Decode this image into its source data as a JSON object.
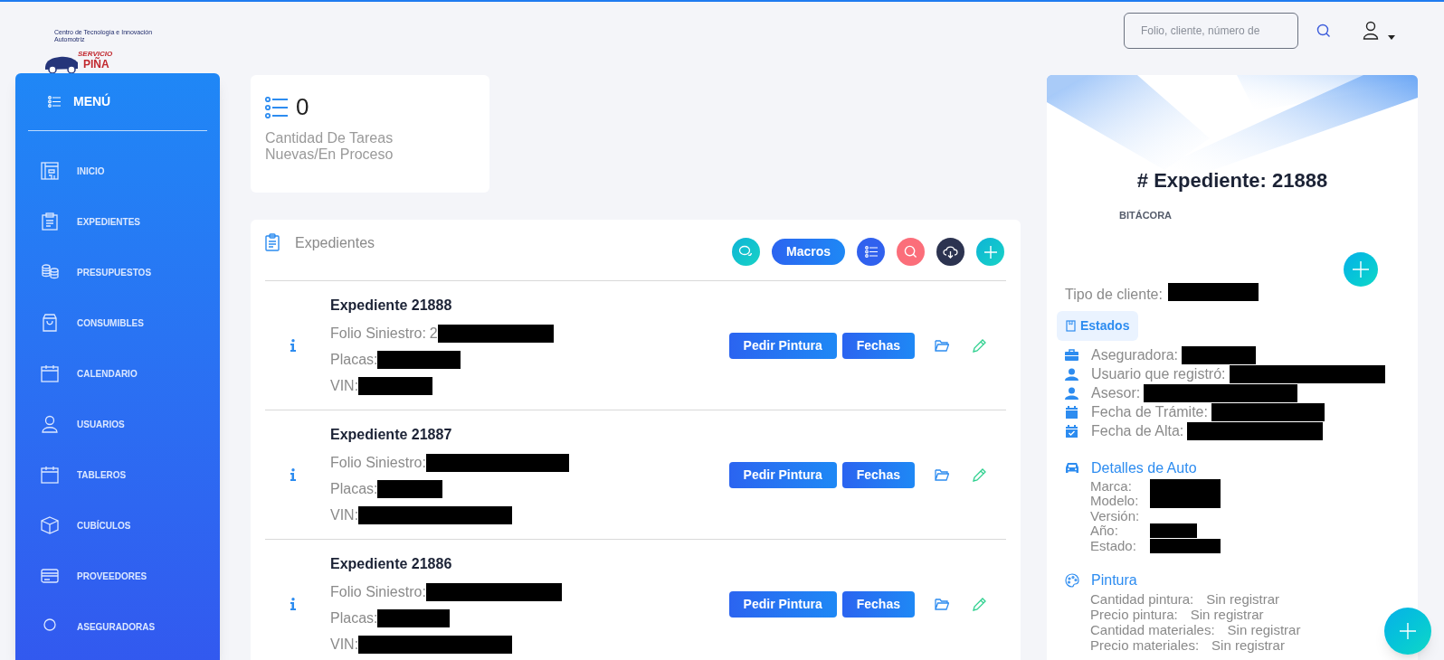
{
  "header": {
    "search": {
      "placeholder": "Folio, cliente, número de"
    }
  },
  "logo": {
    "tagline": "Centro de Tecnología e Innovación Automotriz",
    "brand_top": "SERVICIO",
    "brand_bottom": "PIÑA"
  },
  "sidebar": {
    "title": "MENÚ",
    "items": [
      {
        "label": "INICIO"
      },
      {
        "label": "EXPEDIENTES"
      },
      {
        "label": "PRESUPUESTOS"
      },
      {
        "label": "CONSUMIBLES"
      },
      {
        "label": "CALENDARIO"
      },
      {
        "label": "USUARIOS"
      },
      {
        "label": "TABLEROS"
      },
      {
        "label": "CUBÍCULOS"
      },
      {
        "label": "PROVEEDORES"
      },
      {
        "label": "ASEGURADORAS"
      }
    ]
  },
  "stat_card": {
    "value": "0",
    "label": "Cantidad De Tareas Nuevas/En Proceso"
  },
  "expedientes": {
    "title": "Expedientes",
    "toolbar": {
      "macros_label": "Macros"
    },
    "rows": [
      {
        "title": "Expediente 21888",
        "fields": [
          {
            "label": "Folio Siniestro:",
            "value": "2",
            "redacted": true
          },
          {
            "label": "Placas:",
            "redacted": true
          },
          {
            "label": "VIN:",
            "redacted": true
          }
        ],
        "buttons": [
          "Pedir Pintura",
          "Fechas"
        ]
      },
      {
        "title": "Expediente 21887",
        "fields": [
          {
            "label": "Folio Siniestro:",
            "redacted": true
          },
          {
            "label": "Placas:",
            "redacted": true
          },
          {
            "label": "VIN:",
            "redacted": true
          }
        ],
        "buttons": [
          "Pedir Pintura",
          "Fechas"
        ]
      },
      {
        "title": "Expediente 21886",
        "fields": [
          {
            "label": "Folio Siniestro:",
            "redacted": true
          },
          {
            "label": "Placas:",
            "redacted": true
          },
          {
            "label": "VIN:",
            "redacted": true
          }
        ],
        "buttons": [
          "Pedir Pintura",
          "Fechas"
        ]
      }
    ]
  },
  "detail": {
    "title": "# Expediente: 21888",
    "subtitle": "BITÁCORA",
    "client_type": {
      "label": "Tipo de cliente:",
      "redacted": true
    },
    "tabs": [
      {
        "label": "Estados",
        "selected": true
      }
    ],
    "info": [
      {
        "label": "Aseguradora:",
        "redacted": true
      },
      {
        "label": "Usuario que registró:",
        "redacted": true
      },
      {
        "label": "Asesor:",
        "redacted": true
      },
      {
        "label": "Fecha de Trámite:",
        "redacted": true
      },
      {
        "label": "Fecha de Alta:",
        "redacted": true
      }
    ],
    "auto": {
      "title": "Detalles de Auto",
      "fields": [
        {
          "label": "Marca:",
          "redacted": true
        },
        {
          "label": "Modelo:",
          "redacted": true
        },
        {
          "label": "Versión:",
          "redacted": false
        },
        {
          "label": "Año:",
          "redacted": true
        },
        {
          "label": "Estado:",
          "redacted": true
        }
      ]
    },
    "paint": {
      "title": "Pintura",
      "fields": [
        {
          "label": "Cantidad pintura:",
          "value": "Sin registrar"
        },
        {
          "label": "Precio pintura:",
          "value": "Sin registrar"
        },
        {
          "label": "Cantidad materiales:",
          "value": "Sin registrar"
        },
        {
          "label": "Precio materiales:",
          "value": "Sin registrar"
        }
      ]
    }
  }
}
